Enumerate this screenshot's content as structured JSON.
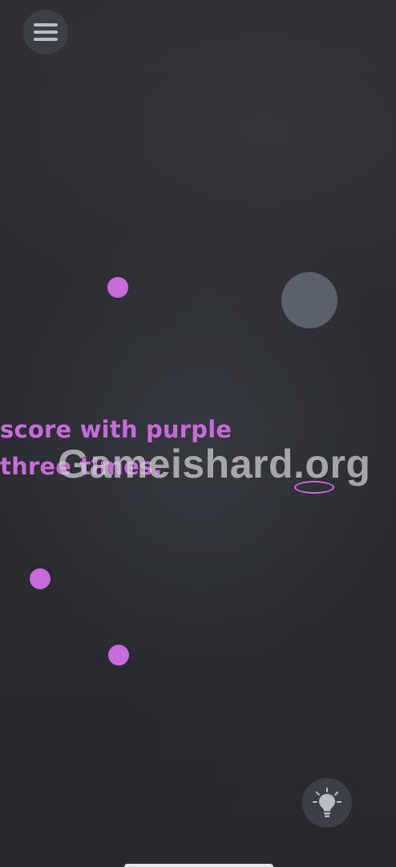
{
  "game": {
    "instruction_lines": [
      "score with purple",
      "three times."
    ],
    "watermark": "Gameishard.org",
    "colors": {
      "background": "#2a2c31",
      "purple": "#c66bd9",
      "grey_ball": "#5a616a",
      "button_bg": "#3c3f46",
      "icon": "#b9bcc3"
    },
    "icons": {
      "menu": "hamburger-menu-icon",
      "hint": "lightbulb-icon"
    }
  }
}
